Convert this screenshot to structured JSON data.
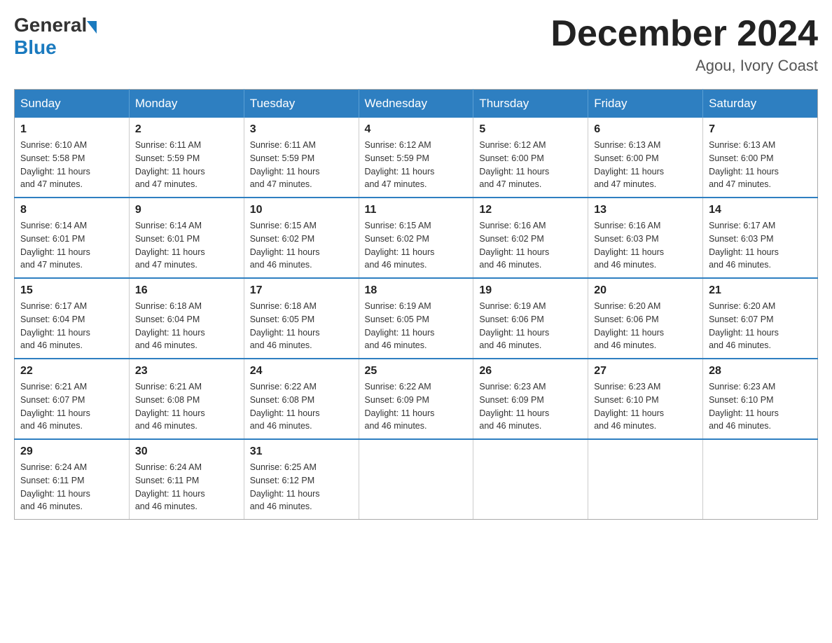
{
  "header": {
    "logo_general": "General",
    "logo_blue": "Blue",
    "month_title": "December 2024",
    "location": "Agou, Ivory Coast"
  },
  "days_of_week": [
    "Sunday",
    "Monday",
    "Tuesday",
    "Wednesday",
    "Thursday",
    "Friday",
    "Saturday"
  ],
  "weeks": [
    [
      {
        "day": "1",
        "sunrise": "6:10 AM",
        "sunset": "5:58 PM",
        "daylight": "11 hours and 47 minutes."
      },
      {
        "day": "2",
        "sunrise": "6:11 AM",
        "sunset": "5:59 PM",
        "daylight": "11 hours and 47 minutes."
      },
      {
        "day": "3",
        "sunrise": "6:11 AM",
        "sunset": "5:59 PM",
        "daylight": "11 hours and 47 minutes."
      },
      {
        "day": "4",
        "sunrise": "6:12 AM",
        "sunset": "5:59 PM",
        "daylight": "11 hours and 47 minutes."
      },
      {
        "day": "5",
        "sunrise": "6:12 AM",
        "sunset": "6:00 PM",
        "daylight": "11 hours and 47 minutes."
      },
      {
        "day": "6",
        "sunrise": "6:13 AM",
        "sunset": "6:00 PM",
        "daylight": "11 hours and 47 minutes."
      },
      {
        "day": "7",
        "sunrise": "6:13 AM",
        "sunset": "6:00 PM",
        "daylight": "11 hours and 47 minutes."
      }
    ],
    [
      {
        "day": "8",
        "sunrise": "6:14 AM",
        "sunset": "6:01 PM",
        "daylight": "11 hours and 47 minutes."
      },
      {
        "day": "9",
        "sunrise": "6:14 AM",
        "sunset": "6:01 PM",
        "daylight": "11 hours and 47 minutes."
      },
      {
        "day": "10",
        "sunrise": "6:15 AM",
        "sunset": "6:02 PM",
        "daylight": "11 hours and 46 minutes."
      },
      {
        "day": "11",
        "sunrise": "6:15 AM",
        "sunset": "6:02 PM",
        "daylight": "11 hours and 46 minutes."
      },
      {
        "day": "12",
        "sunrise": "6:16 AM",
        "sunset": "6:02 PM",
        "daylight": "11 hours and 46 minutes."
      },
      {
        "day": "13",
        "sunrise": "6:16 AM",
        "sunset": "6:03 PM",
        "daylight": "11 hours and 46 minutes."
      },
      {
        "day": "14",
        "sunrise": "6:17 AM",
        "sunset": "6:03 PM",
        "daylight": "11 hours and 46 minutes."
      }
    ],
    [
      {
        "day": "15",
        "sunrise": "6:17 AM",
        "sunset": "6:04 PM",
        "daylight": "11 hours and 46 minutes."
      },
      {
        "day": "16",
        "sunrise": "6:18 AM",
        "sunset": "6:04 PM",
        "daylight": "11 hours and 46 minutes."
      },
      {
        "day": "17",
        "sunrise": "6:18 AM",
        "sunset": "6:05 PM",
        "daylight": "11 hours and 46 minutes."
      },
      {
        "day": "18",
        "sunrise": "6:19 AM",
        "sunset": "6:05 PM",
        "daylight": "11 hours and 46 minutes."
      },
      {
        "day": "19",
        "sunrise": "6:19 AM",
        "sunset": "6:06 PM",
        "daylight": "11 hours and 46 minutes."
      },
      {
        "day": "20",
        "sunrise": "6:20 AM",
        "sunset": "6:06 PM",
        "daylight": "11 hours and 46 minutes."
      },
      {
        "day": "21",
        "sunrise": "6:20 AM",
        "sunset": "6:07 PM",
        "daylight": "11 hours and 46 minutes."
      }
    ],
    [
      {
        "day": "22",
        "sunrise": "6:21 AM",
        "sunset": "6:07 PM",
        "daylight": "11 hours and 46 minutes."
      },
      {
        "day": "23",
        "sunrise": "6:21 AM",
        "sunset": "6:08 PM",
        "daylight": "11 hours and 46 minutes."
      },
      {
        "day": "24",
        "sunrise": "6:22 AM",
        "sunset": "6:08 PM",
        "daylight": "11 hours and 46 minutes."
      },
      {
        "day": "25",
        "sunrise": "6:22 AM",
        "sunset": "6:09 PM",
        "daylight": "11 hours and 46 minutes."
      },
      {
        "day": "26",
        "sunrise": "6:23 AM",
        "sunset": "6:09 PM",
        "daylight": "11 hours and 46 minutes."
      },
      {
        "day": "27",
        "sunrise": "6:23 AM",
        "sunset": "6:10 PM",
        "daylight": "11 hours and 46 minutes."
      },
      {
        "day": "28",
        "sunrise": "6:23 AM",
        "sunset": "6:10 PM",
        "daylight": "11 hours and 46 minutes."
      }
    ],
    [
      {
        "day": "29",
        "sunrise": "6:24 AM",
        "sunset": "6:11 PM",
        "daylight": "11 hours and 46 minutes."
      },
      {
        "day": "30",
        "sunrise": "6:24 AM",
        "sunset": "6:11 PM",
        "daylight": "11 hours and 46 minutes."
      },
      {
        "day": "31",
        "sunrise": "6:25 AM",
        "sunset": "6:12 PM",
        "daylight": "11 hours and 46 minutes."
      },
      null,
      null,
      null,
      null
    ]
  ],
  "labels": {
    "sunrise": "Sunrise:",
    "sunset": "Sunset:",
    "daylight": "Daylight:"
  }
}
